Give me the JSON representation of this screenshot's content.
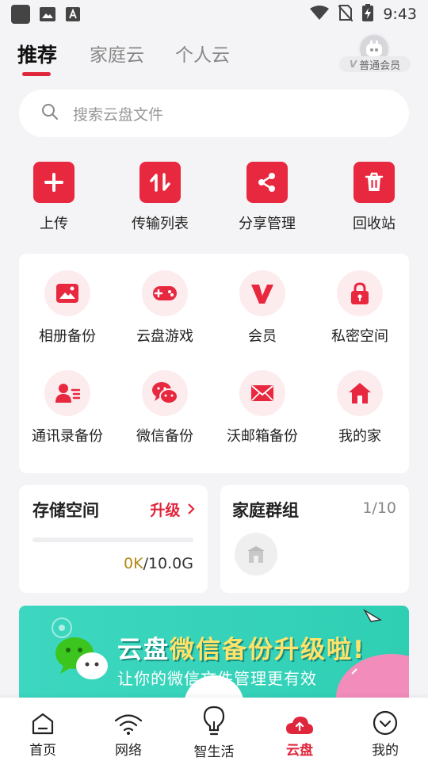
{
  "status_bar": {
    "time": "9:43"
  },
  "top_tabs": [
    {
      "label": "推荐"
    },
    {
      "label": "家庭云"
    },
    {
      "label": "个人云"
    }
  ],
  "member": {
    "label": "普通会员"
  },
  "search": {
    "placeholder": "搜索云盘文件"
  },
  "quick_actions": [
    {
      "label": "上传",
      "icon": "plus-icon"
    },
    {
      "label": "传输列表",
      "icon": "transfer-arrows-icon"
    },
    {
      "label": "分享管理",
      "icon": "share-icon"
    },
    {
      "label": "回收站",
      "icon": "trash-icon"
    }
  ],
  "services": [
    {
      "label": "相册备份",
      "icon": "photo-icon"
    },
    {
      "label": "云盘游戏",
      "icon": "gamepad-icon"
    },
    {
      "label": "会员",
      "icon": "vip-icon"
    },
    {
      "label": "私密空间",
      "icon": "lock-icon"
    },
    {
      "label": "通讯录备份",
      "icon": "contacts-icon"
    },
    {
      "label": "微信备份",
      "icon": "wechat-icon"
    },
    {
      "label": "沃邮箱备份",
      "icon": "mail-icon"
    },
    {
      "label": "我的家",
      "icon": "home-icon"
    }
  ],
  "storage": {
    "title": "存储空间",
    "upgrade_label": "升级",
    "used": "0K",
    "total": "/10.0G",
    "used_fraction": 0
  },
  "family_group": {
    "title": "家庭群组",
    "count": "1/10"
  },
  "banner": {
    "title_part1": "云盘",
    "title_part2": "微信备份升级啦!",
    "subtitle": "让你的微信文件管理更有效"
  },
  "bottom_nav": [
    {
      "label": "首页",
      "icon": "home-outline-icon"
    },
    {
      "label": "网络",
      "icon": "wifi-icon"
    },
    {
      "label": "智生活",
      "icon": "lightbulb-icon"
    },
    {
      "label": "云盘",
      "icon": "cloud-upload-icon",
      "active": true
    },
    {
      "label": "我的",
      "icon": "profile-chevron-icon"
    }
  ],
  "colors": {
    "accent": "#e0263c",
    "icon_bg": "#fdecee",
    "banner": "#3dd7c0"
  }
}
